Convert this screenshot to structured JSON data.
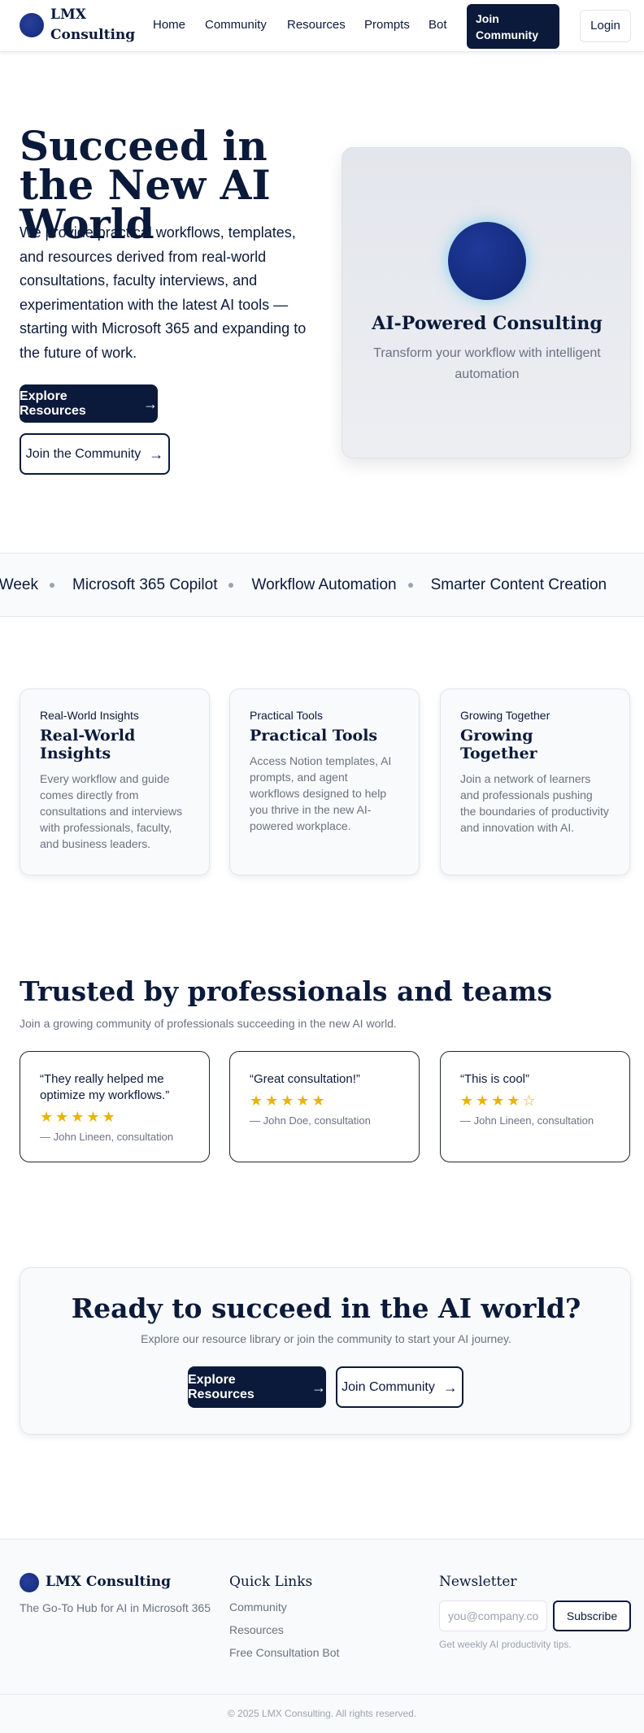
{
  "header": {
    "logo_text": "LMX Consulting",
    "nav": [
      "Home",
      "Community",
      "Resources",
      "Prompts",
      "Bot"
    ],
    "join_label": "Join Community",
    "login_label": "Login"
  },
  "hero": {
    "title": "Succeed in the New AI World",
    "description": "We provide practical workflows, templates, and resources derived from real-world consultations, faculty interviews, and experimentation with the latest AI tools — starting with Microsoft 365 and expanding to the future of work.",
    "primary_label": "Explore Resources",
    "secondary_label": "Join the Community",
    "card_title": "AI-Powered Consulting",
    "card_subtitle": "Transform your workflow with intelligent automation"
  },
  "ticker": [
    "s/Week",
    "Microsoft 365 Copilot",
    "Workflow Automation",
    "Smarter Content Creation"
  ],
  "features": [
    {
      "kicker": "Real-World Insights",
      "title": "Real-World Insights",
      "desc": "Every workflow and guide comes directly from consultations and interviews with professionals, faculty, and business leaders."
    },
    {
      "kicker": "Practical Tools",
      "title": "Practical Tools",
      "desc": "Access Notion templates, AI prompts, and agent workflows designed to help you thrive in the new AI-powered workplace."
    },
    {
      "kicker": "Growing Together",
      "title": "Growing Together",
      "desc": "Join a network of learners and professionals pushing the boundaries of productivity and innovation with AI."
    }
  ],
  "testimonials": {
    "title": "Trusted by professionals and teams",
    "subtitle": "Join a growing community of professionals succeeding in the new AI world.",
    "items": [
      {
        "quote": "“They really helped me optimize my workflows.”",
        "rating": 5,
        "stars": "★★★★★",
        "author": "— John Lineen, consultation"
      },
      {
        "quote": "“Great consultation!”",
        "rating": 5,
        "stars": "★★★★★",
        "author": "— John Doe, consultation"
      },
      {
        "quote": "“This is cool”",
        "rating": 4,
        "stars": "★★★★☆",
        "author": "— John Lineen, consultation"
      }
    ]
  },
  "cta": {
    "title": "Ready to succeed in the AI world?",
    "subtitle": "Explore our resource library or join the community to start your AI journey.",
    "primary_label": "Explore Resources",
    "secondary_label": "Join Community"
  },
  "footer": {
    "brand": "LMX Consulting",
    "tagline": "The Go-To Hub for AI in Microsoft 365",
    "quick_links_title": "Quick Links",
    "quick_links": [
      "Community",
      "Resources",
      "Free Consultation Bot"
    ],
    "newsletter_title": "Newsletter",
    "newsletter_placeholder": "you@company.com",
    "subscribe_label": "Subscribe",
    "newsletter_note": "Get weekly AI productivity tips.",
    "copyright": "© 2025 LMX Consulting. All rights reserved."
  },
  "colors": {
    "navy": "#0b1a3a",
    "accent_blue": "#1f3a9a",
    "star": "#eab308",
    "muted": "#6b7280"
  }
}
